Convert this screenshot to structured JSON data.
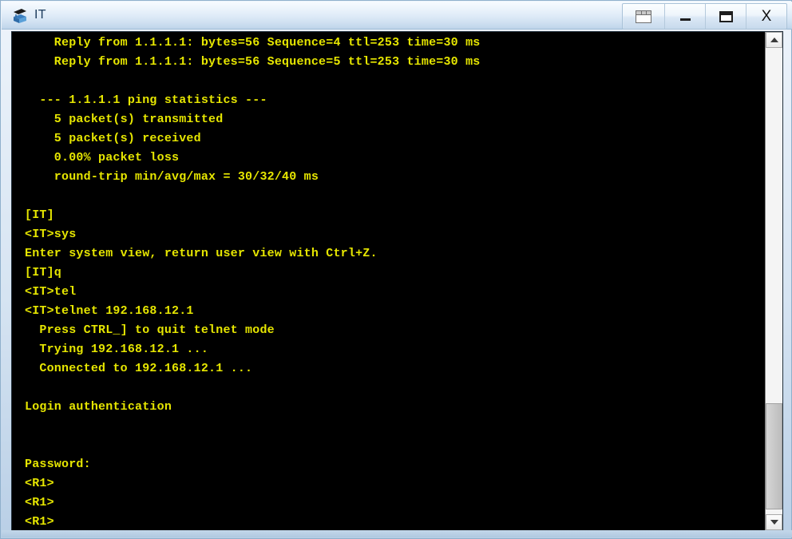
{
  "window": {
    "title": "IT",
    "icon": "router-device-icon",
    "controls": [
      {
        "name": "tile-windows-button",
        "icon": "tile-windows-icon",
        "label": ""
      },
      {
        "name": "minimize-button",
        "icon": "minimize-icon",
        "label": ""
      },
      {
        "name": "maximize-button",
        "icon": "maximize-icon",
        "label": ""
      },
      {
        "name": "close-button",
        "icon": "close-icon",
        "label": "X"
      }
    ]
  },
  "terminal": {
    "foreground_color": "#e6e600",
    "background_color": "#000000",
    "lines": [
      "    Reply from 1.1.1.1: bytes=56 Sequence=4 ttl=253 time=30 ms",
      "    Reply from 1.1.1.1: bytes=56 Sequence=5 ttl=253 time=30 ms",
      "",
      "  --- 1.1.1.1 ping statistics ---",
      "    5 packet(s) transmitted",
      "    5 packet(s) received",
      "    0.00% packet loss",
      "    round-trip min/avg/max = 30/32/40 ms",
      "",
      "[IT]",
      "<IT>sys",
      "Enter system view, return user view with Ctrl+Z.",
      "[IT]q",
      "<IT>tel",
      "<IT>telnet 192.168.12.1",
      "  Press CTRL_] to quit telnet mode",
      "  Trying 192.168.12.1 ...",
      "  Connected to 192.168.12.1 ...",
      "",
      "Login authentication",
      "",
      "",
      "Password:",
      "<R1>",
      "<R1>",
      "<R1>"
    ]
  },
  "scrollbar": {
    "up_arrow": "scroll-up-icon",
    "down_arrow": "scroll-down-icon",
    "thumb": "scroll-thumb"
  }
}
